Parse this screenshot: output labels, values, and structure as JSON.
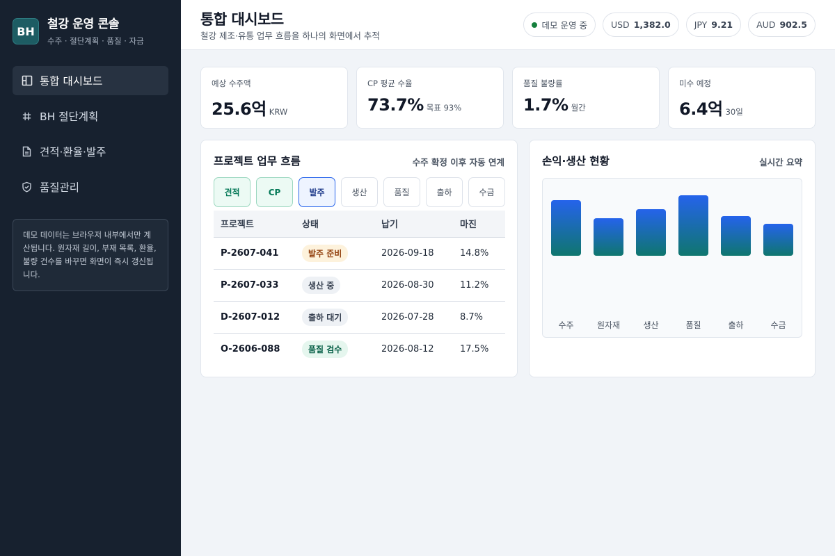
{
  "brand": {
    "logo": "BH",
    "title": "철강 운영 콘솔",
    "subtitle": "수주 · 절단계획 · 품질 · 자금"
  },
  "nav": [
    {
      "label": "통합 대시보드",
      "icon": "dashboard-icon",
      "active": true
    },
    {
      "label": "BH 절단계획",
      "icon": "hash-icon",
      "active": false
    },
    {
      "label": "견적·환율·발주",
      "icon": "document-icon",
      "active": false
    },
    {
      "label": "품질관리",
      "icon": "shield-check-icon",
      "active": false
    }
  ],
  "note": "데모 데이터는 브라우저 내부에서만 계산됩니다. 원자재 길이, 부재 목록, 환율, 불량 건수를 바꾸면 화면이 즉시 갱신됩니다.",
  "header": {
    "title": "통합 대시보드",
    "subtitle": "철강 제조·유통 업무 흐름을 하나의 화면에서 추적",
    "status": "데모 운영 중",
    "rates": [
      {
        "code": "USD",
        "value": "1,382.0"
      },
      {
        "code": "JPY",
        "value": "9.21"
      },
      {
        "code": "AUD",
        "value": "902.5"
      }
    ]
  },
  "stats": [
    {
      "label": "예상 수주액",
      "value": "25.6억",
      "unit": "KRW"
    },
    {
      "label": "CP 평균 수율",
      "value": "73.7%",
      "unit": "목표 93%"
    },
    {
      "label": "품질 불량률",
      "value": "1.7%",
      "unit": "월간"
    },
    {
      "label": "미수 예정",
      "value": "6.4억",
      "unit": "30일"
    }
  ],
  "workflow": {
    "title": "프로젝트 업무 흐름",
    "meta": "수주 확정 이후 자동 연계",
    "steps": [
      {
        "label": "견적",
        "state": "done"
      },
      {
        "label": "CP",
        "state": "done"
      },
      {
        "label": "발주",
        "state": "current"
      },
      {
        "label": "생산",
        "state": "pending"
      },
      {
        "label": "품질",
        "state": "pending"
      },
      {
        "label": "출하",
        "state": "pending"
      },
      {
        "label": "수금",
        "state": "pending"
      }
    ],
    "columns": [
      "프로젝트",
      "상태",
      "납기",
      "마진"
    ],
    "rows": [
      {
        "id": "P-2607-041",
        "status": "발주 준비",
        "tone": "warn",
        "due": "2026-09-18",
        "margin": "14.8%"
      },
      {
        "id": "P-2607-033",
        "status": "생산 중",
        "tone": "gray",
        "due": "2026-08-30",
        "margin": "11.2%"
      },
      {
        "id": "D-2607-012",
        "status": "출하 대기",
        "tone": "gray",
        "due": "2026-07-28",
        "margin": "8.7%"
      },
      {
        "id": "O-2606-088",
        "status": "품질 검수",
        "tone": "green",
        "due": "2026-08-12",
        "margin": "17.5%"
      }
    ]
  },
  "pl": {
    "title": "손익·생산 현황",
    "meta": "실시간 요약"
  },
  "chart_data": {
    "type": "bar",
    "categories": [
      "수주",
      "원자재",
      "생산",
      "품질",
      "출하",
      "수금"
    ],
    "values": [
      80,
      54,
      67,
      87,
      57,
      46
    ],
    "ylim": [
      0,
      100
    ],
    "grid": false,
    "colors": {
      "top": "#2563eb",
      "bottom": "#0f766e"
    }
  }
}
